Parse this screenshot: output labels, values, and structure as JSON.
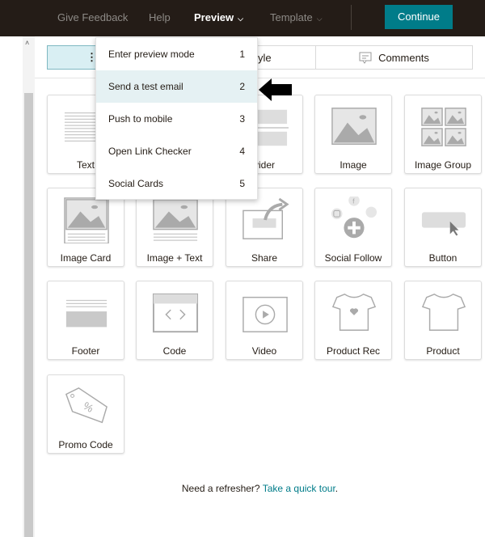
{
  "topbar": {
    "give_feedback": "Give Feedback",
    "help": "Help",
    "preview": "Preview",
    "template": "Template",
    "continue": "Continue"
  },
  "tabs": {
    "style_partial": "yle",
    "comments": "Comments"
  },
  "preview_menu": [
    {
      "label": "Enter preview mode",
      "shortcut": "1"
    },
    {
      "label": "Send a test email",
      "shortcut": "2",
      "highlighted": true
    },
    {
      "label": "Push to mobile",
      "shortcut": "3"
    },
    {
      "label": "Open Link Checker",
      "shortcut": "4"
    },
    {
      "label": "Social Cards",
      "shortcut": "5"
    }
  ],
  "blocks": [
    {
      "label": "Text",
      "icon": "text-icon"
    },
    {
      "label": "",
      "icon": "boxed-text-icon"
    },
    {
      "label": "vider",
      "icon": "divider-icon"
    },
    {
      "label": "Image",
      "icon": "image-icon"
    },
    {
      "label": "Image Group",
      "icon": "image-group-icon"
    },
    {
      "label": "Image Card",
      "icon": "image-card-icon"
    },
    {
      "label": "Image + Text",
      "icon": "image-text-icon"
    },
    {
      "label": "Share",
      "icon": "share-icon"
    },
    {
      "label": "Social Follow",
      "icon": "social-follow-icon"
    },
    {
      "label": "Button",
      "icon": "button-icon"
    },
    {
      "label": "Footer",
      "icon": "footer-icon"
    },
    {
      "label": "Code",
      "icon": "code-icon"
    },
    {
      "label": "Video",
      "icon": "video-icon"
    },
    {
      "label": "Product Rec",
      "icon": "product-rec-icon"
    },
    {
      "label": "Product",
      "icon": "product-icon"
    },
    {
      "label": "Promo Code",
      "icon": "promo-code-icon"
    }
  ],
  "footer": {
    "text": "Need a refresher?",
    "link": "Take a quick tour",
    "period": "."
  },
  "colors": {
    "topbar": "#241c17",
    "accent": "#007c89",
    "highlight": "#e5f1f3"
  }
}
